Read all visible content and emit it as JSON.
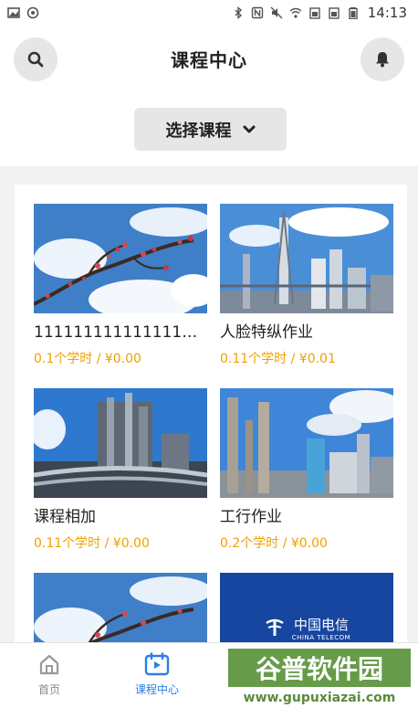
{
  "status_bar": {
    "time": "14:13"
  },
  "header": {
    "title": "课程中心",
    "select_label": "选择课程"
  },
  "courses": [
    {
      "title": "1111111111111111111",
      "meta": "0.1个学时 / ¥0.00",
      "image": "plum-blossom"
    },
    {
      "title": "人脸特纵作业",
      "meta": "0.11个学时 / ¥0.01",
      "image": "refinery"
    },
    {
      "title": "课程相加",
      "meta": "0.11个学时 / ¥0.00",
      "image": "chemical-plant"
    },
    {
      "title": "工行作业",
      "meta": "0.2个学时 / ¥0.00",
      "image": "factory-chimneys"
    },
    {
      "title": "",
      "meta": "",
      "image": "plum-blossom"
    },
    {
      "title": "",
      "meta": "",
      "image": "china-telecom-logo",
      "logo_text": "中国电信",
      "logo_sub": "CHINA TELECOM"
    }
  ],
  "tabs": [
    {
      "label": "首页",
      "icon": "home-icon",
      "active": false
    },
    {
      "label": "课程中心",
      "icon": "calendar-play-icon",
      "active": true
    }
  ],
  "watermark": {
    "text": "谷普软件园",
    "url": "www.gupuxiazai.com"
  },
  "colors": {
    "accent": "#2a7fe0",
    "price": "#f0a000",
    "telecom_blue": "#1746a0"
  }
}
